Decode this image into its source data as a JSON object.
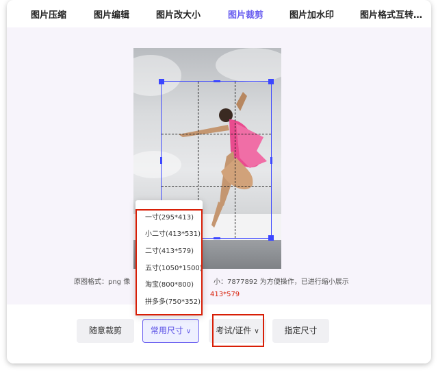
{
  "tabs": [
    {
      "label": "图片压缩",
      "active": false
    },
    {
      "label": "图片编辑",
      "active": false
    },
    {
      "label": "图片改大小",
      "active": false
    },
    {
      "label": "图片裁剪",
      "active": true
    },
    {
      "label": "图片加水印",
      "active": false
    },
    {
      "label": "图片格式互转…",
      "active": false
    }
  ],
  "info": {
    "left": "原图格式：png   像",
    "right": "小：7877892   为方便操作，已进行缩小展示",
    "current_size": "413*579"
  },
  "dropdown": {
    "items": [
      "一寸(295*413)",
      "小二寸(413*531)",
      "二寸(413*579)",
      "五寸(1050*1500)",
      "淘宝(800*800)",
      "拼多多(750*352)"
    ]
  },
  "buttons": {
    "free_crop": "随意裁剪",
    "common_size": "常用尺寸",
    "exam_id": "考试/证件",
    "custom_size": "指定尺寸",
    "chevron": "∨"
  },
  "colors": {
    "accent": "#6a5ff0",
    "crop_border": "#3b46ff",
    "highlight": "#d81e06"
  }
}
